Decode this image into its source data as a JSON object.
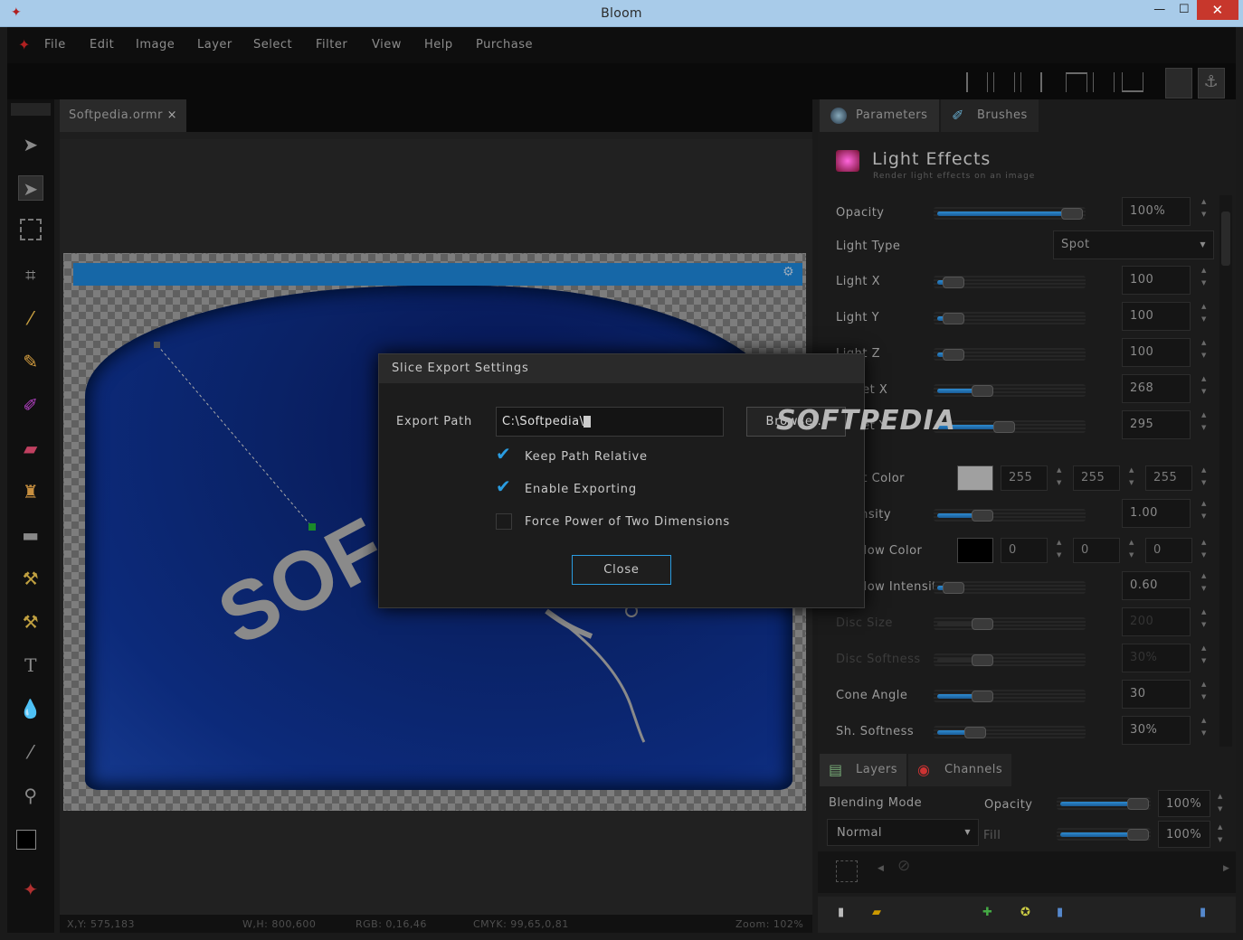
{
  "window": {
    "title": "Bloom",
    "minimize": "—",
    "maximize": "☐",
    "close": "✕"
  },
  "menu": [
    "File",
    "Edit",
    "Image",
    "Layer",
    "Select",
    "Filter",
    "View",
    "Help",
    "Purchase"
  ],
  "document": {
    "tab_label": "Softpedia.ormr",
    "tab_close": "×"
  },
  "status": {
    "xy": "X,Y: 575,183",
    "wh": "W,H: 800,600",
    "rgb": "RGB: 0,16,46",
    "cmyk": "CMYK: 99,65,0,81",
    "zoom": "Zoom: 102%"
  },
  "panel": {
    "tabs": [
      "Parameters",
      "Brushes"
    ],
    "effect_title": "Light Effects",
    "effect_subtitle": "Render light effects on an image",
    "rows": [
      {
        "label": "Opacity",
        "value": "100%",
        "fill": 0.92,
        "dim": false
      },
      {
        "label": "Light Type",
        "value": "Spot",
        "dim": false
      },
      {
        "label": "Light X",
        "value": "100",
        "fill": 0.1,
        "dim": false
      },
      {
        "label": "Light Y",
        "value": "100",
        "fill": 0.1,
        "dim": false
      },
      {
        "label": "Light Z",
        "value": "100",
        "fill": 0.1,
        "dim": false
      },
      {
        "label": "Target X",
        "value": "268",
        "fill": 0.3,
        "dim": false
      },
      {
        "label": "Target Y",
        "value": "295",
        "fill": 0.45,
        "dim": false
      },
      {
        "label": "Light Color",
        "value": "",
        "dim": false
      },
      {
        "label": "Intensity",
        "value": "1.00",
        "fill": 0.3,
        "dim": false
      },
      {
        "label": "Shadow Color",
        "value": "",
        "dim": false
      },
      {
        "label": "Shadow Intensity",
        "value": "0.60",
        "fill": 0.1,
        "dim": false
      },
      {
        "label": "Disc Size",
        "value": "200",
        "fill": 0.3,
        "dim": true
      },
      {
        "label": "Disc Softness",
        "value": "30%",
        "fill": 0.3,
        "dim": true
      },
      {
        "label": "Cone Angle",
        "value": "30",
        "fill": 0.3,
        "dim": false
      },
      {
        "label": "Sh. Softness",
        "value": "30%",
        "fill": 0.25,
        "dim": false
      }
    ],
    "light_color": {
      "r": "255",
      "g": "255",
      "b": "255",
      "swatch": "#a0a0a0"
    },
    "shadow_color": {
      "r": "0",
      "g": "0",
      "b": "0",
      "swatch": "#000000"
    }
  },
  "layers": {
    "tabs": [
      "Layers",
      "Channels"
    ],
    "blending_label": "Blending Mode",
    "blending_value": "Normal",
    "opacity_label": "Opacity",
    "opacity_value": "100%",
    "fill_label": "Fill",
    "fill_value": "100%"
  },
  "dialog": {
    "title": "Slice Export Settings",
    "export_path_label": "Export Path",
    "export_path_value": "C:\\Softpedia\\",
    "browse_label": "Browse...",
    "keep_relative": "Keep Path Relative",
    "enable_exporting": "Enable Exporting",
    "power_of_two": "Force Power of Two Dimensions",
    "close_label": "Close",
    "keep_relative_checked": true,
    "enable_exporting_checked": true,
    "power_of_two_checked": false
  },
  "watermark": "SOFTPEDIA",
  "colors": {
    "accent": "#2a9ce0",
    "titlebar": "#a8cbe9",
    "close": "#c7372c"
  }
}
